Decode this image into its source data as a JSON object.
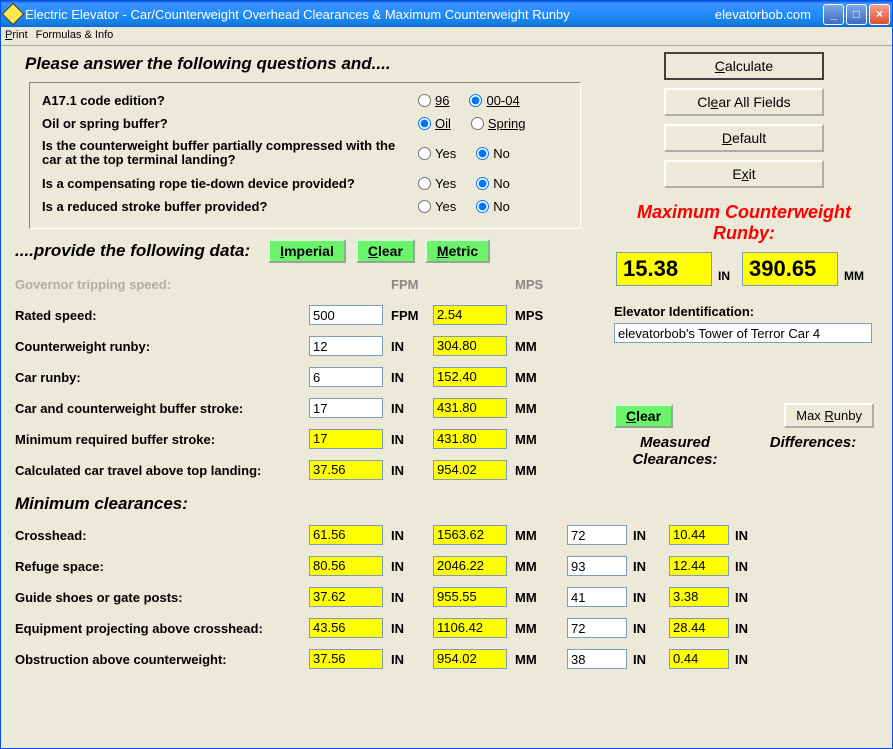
{
  "titlebar": {
    "title": "Electric Elevator - Car/Counterweight Overhead Clearances & Maximum Counterweight Runby",
    "brand": "elevatorbob.com"
  },
  "menu": {
    "print": "Print",
    "formulas": "Formulas & Info"
  },
  "heading1": "Please answer the following questions and....",
  "questions": {
    "q1": {
      "label": "A17.1 code edition?",
      "opt1": "96",
      "opt2": "00-04",
      "sel": 2
    },
    "q2": {
      "label": "Oil or spring buffer?",
      "opt1": "Oil",
      "opt2": "Spring",
      "sel": 1
    },
    "q3": {
      "label": "Is the counterweight buffer partially compressed with the car at the top terminal landing?",
      "opt1": "Yes",
      "opt2": "No",
      "sel": 2
    },
    "q4": {
      "label": "Is a compensating rope tie-down device provided?",
      "opt1": "Yes",
      "opt2": "No",
      "sel": 2
    },
    "q5": {
      "label": "Is a reduced stroke buffer provided?",
      "opt1": "Yes",
      "opt2": "No",
      "sel": 2
    }
  },
  "provide": {
    "label": "....provide the following data:",
    "imperial": "Imperial",
    "clear": "Clear",
    "metric": "Metric"
  },
  "datahdr": {
    "fpm": "FPM",
    "mps": "MPS"
  },
  "datarows": {
    "gov": {
      "label": "Governor tripping speed:"
    },
    "rated": {
      "label": "Rated speed:",
      "in": "500",
      "u1": "FPM",
      "out": "2.54",
      "u2": "MPS"
    },
    "cwrunby": {
      "label": "Counterweight runby:",
      "in": "12",
      "u1": "IN",
      "out": "304.80",
      "u2": "MM"
    },
    "carrunby": {
      "label": "Car runby:",
      "in": "6",
      "u1": "IN",
      "out": "152.40",
      "u2": "MM"
    },
    "bufstroke": {
      "label": "Car and counterweight buffer stroke:",
      "in": "17",
      "u1": "IN",
      "out": "431.80",
      "u2": "MM"
    },
    "minstroke": {
      "label": "Minimum required buffer stroke:",
      "in": "17",
      "u1": "IN",
      "out": "431.80",
      "u2": "MM"
    },
    "calctravel": {
      "label": "Calculated car travel above top landing:",
      "in": "37.56",
      "u1": "IN",
      "out": "954.02",
      "u2": "MM"
    }
  },
  "mincl_h": "Minimum clearances:",
  "clearrows": {
    "crosshead": {
      "label": "Crosshead:",
      "min_in": "61.56",
      "min_mm": "1563.62",
      "meas": "72",
      "diff": "10.44"
    },
    "refuge": {
      "label": "Refuge space:",
      "min_in": "80.56",
      "min_mm": "2046.22",
      "meas": "93",
      "diff": "12.44"
    },
    "guide": {
      "label": "Guide shoes or gate posts:",
      "min_in": "37.62",
      "min_mm": "955.55",
      "meas": "41",
      "diff": "3.38"
    },
    "equip": {
      "label": "Equipment projecting above crosshead:",
      "min_in": "43.56",
      "min_mm": "1106.42",
      "meas": "72",
      "diff": "28.44"
    },
    "obstr": {
      "label": "Obstruction above counterweight:",
      "min_in": "37.56",
      "min_mm": "954.02",
      "meas": "38",
      "diff": "0.44"
    }
  },
  "units": {
    "in": "IN",
    "mm": "MM"
  },
  "right": {
    "calculate": "Calculate",
    "clearall": "Clear All Fields",
    "default": "Default",
    "exit": "Exit",
    "max_title": "Maximum Counterweight Runby:",
    "max_in": "15.38",
    "max_mm": "390.65",
    "elev_id_label": "Elevator Identification:",
    "elev_id": "elevatorbob's Tower of Terror Car 4",
    "clear2": "Clear",
    "maxrunby": "Max Runby",
    "meas_h": "Measured Clearances:",
    "diff_h": "Differences:"
  }
}
